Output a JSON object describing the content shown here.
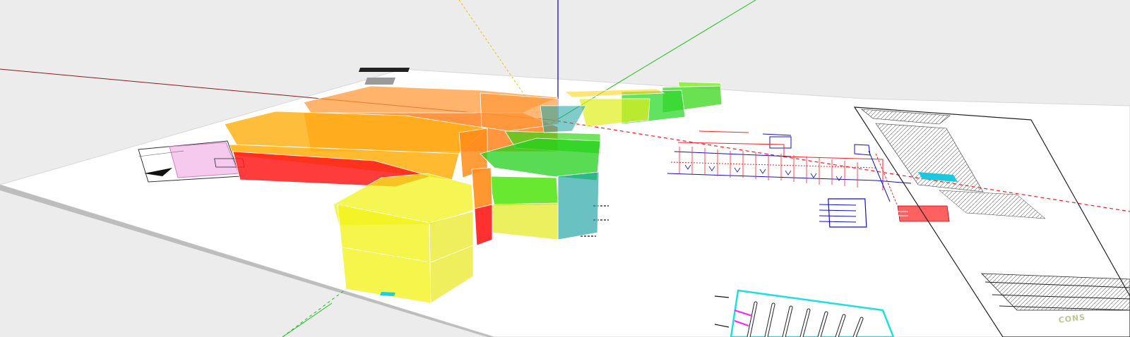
{
  "viewport": {
    "background": "#ececec",
    "ground_color": "#ffffff",
    "axis_colors": {
      "red_axis": "#c00000",
      "green_axis": "#18c418",
      "blue_axis": "#1010d0",
      "guide": "#f0c000"
    }
  },
  "model": {
    "color_legend": {
      "red": "#ff1a1a",
      "orange": "#ff8c1a",
      "amber": "#ffb21a",
      "yellow": "#f2f21a",
      "lime": "#8cf01a",
      "green": "#38d61a",
      "teal": "#1aa0a0"
    }
  },
  "sheet": {
    "title_block_stamp": "CONS"
  }
}
